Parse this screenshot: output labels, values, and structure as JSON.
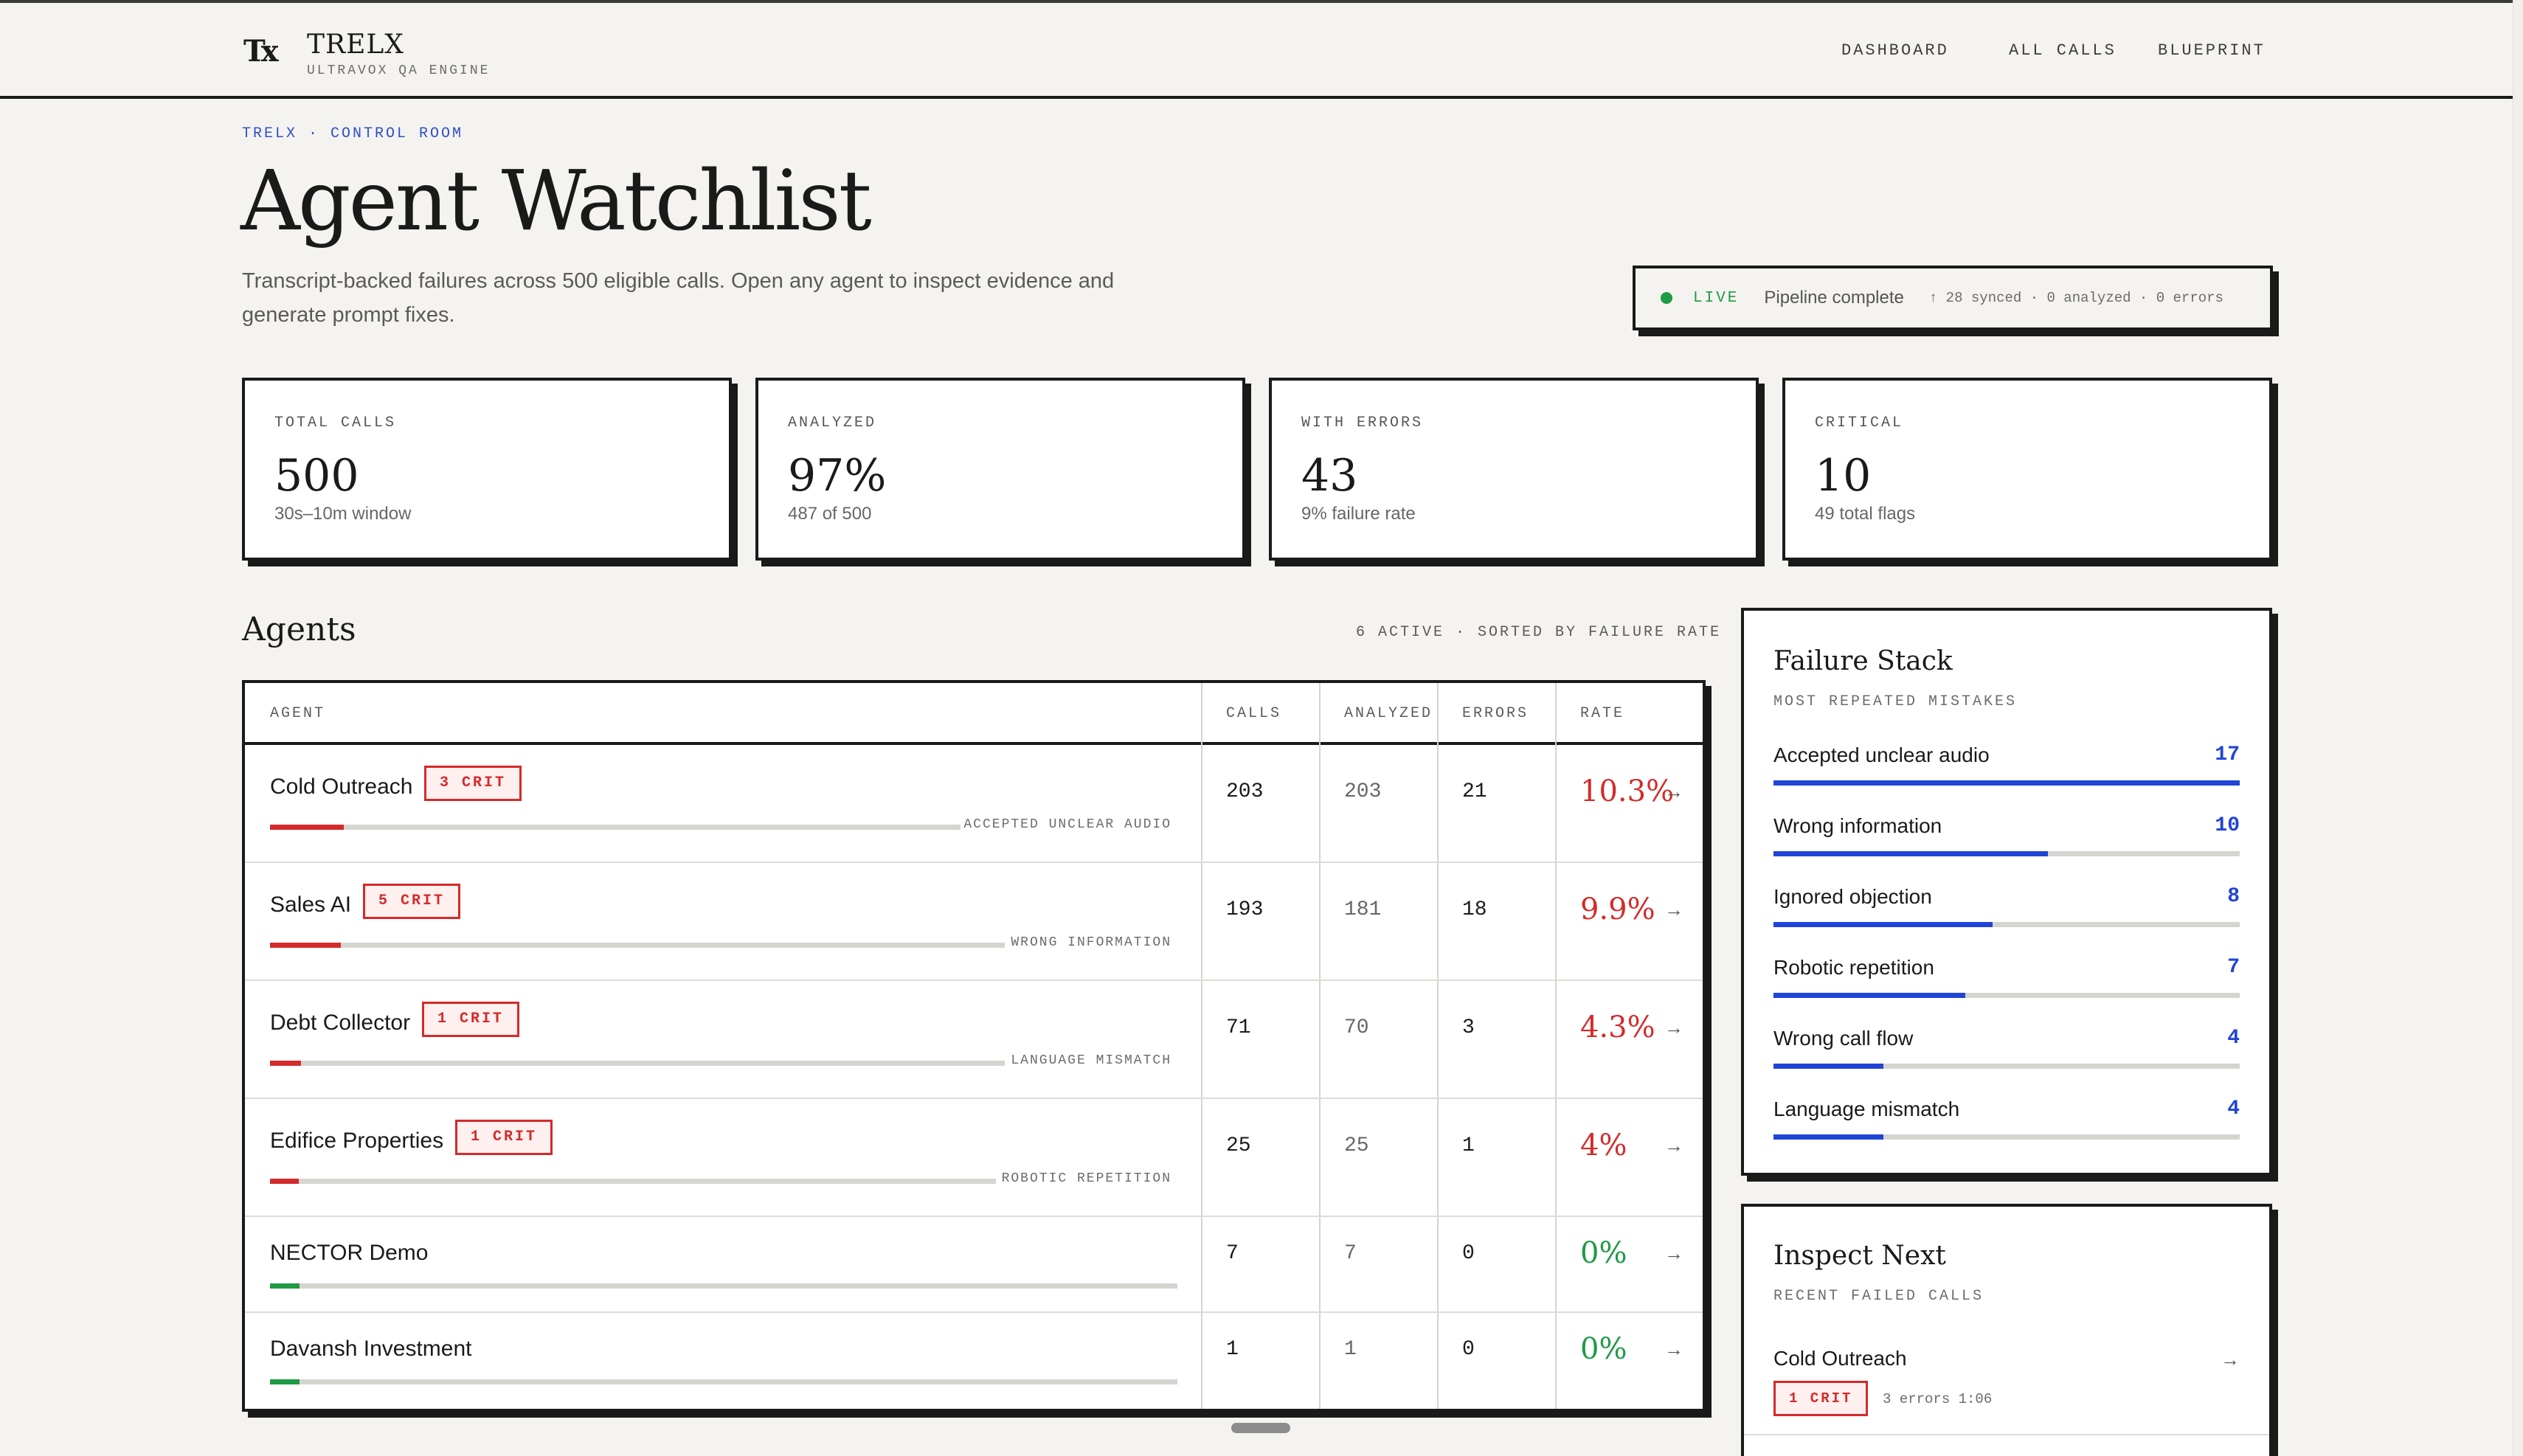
{
  "app": {
    "logo_text": "Tx",
    "brand": "TRELX",
    "brand_sub": "ULTRAVOX QA ENGINE",
    "nav": [
      "DASHBOARD",
      "ALL CALLS",
      "BLUEPRINT"
    ]
  },
  "page": {
    "breadcrumb": "TRELX · CONTROL ROOM",
    "title": "Agent Watchlist",
    "subtitle": "Transcript-backed failures across 500 eligible calls. Open any agent to inspect evidence and generate prompt fixes."
  },
  "status": {
    "live": "LIVE",
    "text": "Pipeline complete",
    "meta": "↑ 28 synced · 0 analyzed · 0 errors",
    "dot_color": "#1f9a45"
  },
  "stats": [
    {
      "label": "TOTAL CALLS",
      "value": "500",
      "note": "30s–10m window"
    },
    {
      "label": "ANALYZED",
      "value": "97%",
      "note": "487 of 500"
    },
    {
      "label": "WITH ERRORS",
      "value": "43",
      "note": "9% failure rate"
    },
    {
      "label": "CRITICAL",
      "value": "10",
      "note": "49 total flags"
    }
  ],
  "agents": {
    "title": "Agents",
    "meta": "6 ACTIVE · SORTED BY FAILURE RATE",
    "columns": [
      "AGENT",
      "CALLS",
      "ANALYZED",
      "ERRORS",
      "RATE"
    ],
    "rows": [
      {
        "name": "Cold Outreach",
        "crit": "3 CRIT",
        "reason": "ACCEPTED UNCLEAR AUDIO",
        "calls": "203",
        "analyzed": "203",
        "errors": "21",
        "rate": "10.3%",
        "rate_value": 0.103,
        "status": "bad"
      },
      {
        "name": "Sales AI",
        "crit": "5 CRIT",
        "reason": "WRONG INFORMATION",
        "calls": "193",
        "analyzed": "181",
        "errors": "18",
        "rate": "9.9%",
        "rate_value": 0.099,
        "status": "bad"
      },
      {
        "name": "Debt Collector",
        "crit": "1 CRIT",
        "reason": "LANGUAGE MISMATCH",
        "calls": "71",
        "analyzed": "70",
        "errors": "3",
        "rate": "4.3%",
        "rate_value": 0.043,
        "status": "bad"
      },
      {
        "name": "Edifice Properties",
        "crit": "1 CRIT",
        "reason": "ROBOTIC REPETITION",
        "calls": "25",
        "analyzed": "25",
        "errors": "1",
        "rate": "4%",
        "rate_value": 0.04,
        "status": "bad"
      },
      {
        "name": "NECTOR Demo",
        "crit": "",
        "reason": "",
        "calls": "7",
        "analyzed": "7",
        "errors": "0",
        "rate": "0%",
        "rate_value": 0.0,
        "status": "ok"
      },
      {
        "name": "Davansh Investment",
        "crit": "",
        "reason": "",
        "calls": "1",
        "analyzed": "1",
        "errors": "0",
        "rate": "0%",
        "rate_value": 0.0,
        "status": "ok"
      }
    ]
  },
  "failure_stack": {
    "title": "Failure Stack",
    "sub": "MOST REPEATED MISTAKES",
    "items": [
      {
        "label": "Accepted unclear audio",
        "count": "17",
        "value": 17
      },
      {
        "label": "Wrong information",
        "count": "10",
        "value": 10
      },
      {
        "label": "Ignored objection",
        "count": "8",
        "value": 8
      },
      {
        "label": "Robotic repetition",
        "count": "7",
        "value": 7
      },
      {
        "label": "Wrong call flow",
        "count": "4",
        "value": 4
      },
      {
        "label": "Language mismatch",
        "count": "4",
        "value": 4
      }
    ]
  },
  "inspect_next": {
    "title": "Inspect Next",
    "sub": "RECENT FAILED CALLS",
    "items": [
      {
        "agent": "Cold Outreach",
        "crit": "1 CRIT",
        "meta": "3 errors 1:06"
      }
    ]
  },
  "colors": {
    "accent": "#1f44d6",
    "critical": "#d42a2a",
    "ok": "#1f9a45",
    "ink": "#1a1a1a",
    "paper": "#f4f3ef"
  },
  "icons": {
    "row_arrow": "→",
    "status_dot": "status-dot-icon"
  }
}
